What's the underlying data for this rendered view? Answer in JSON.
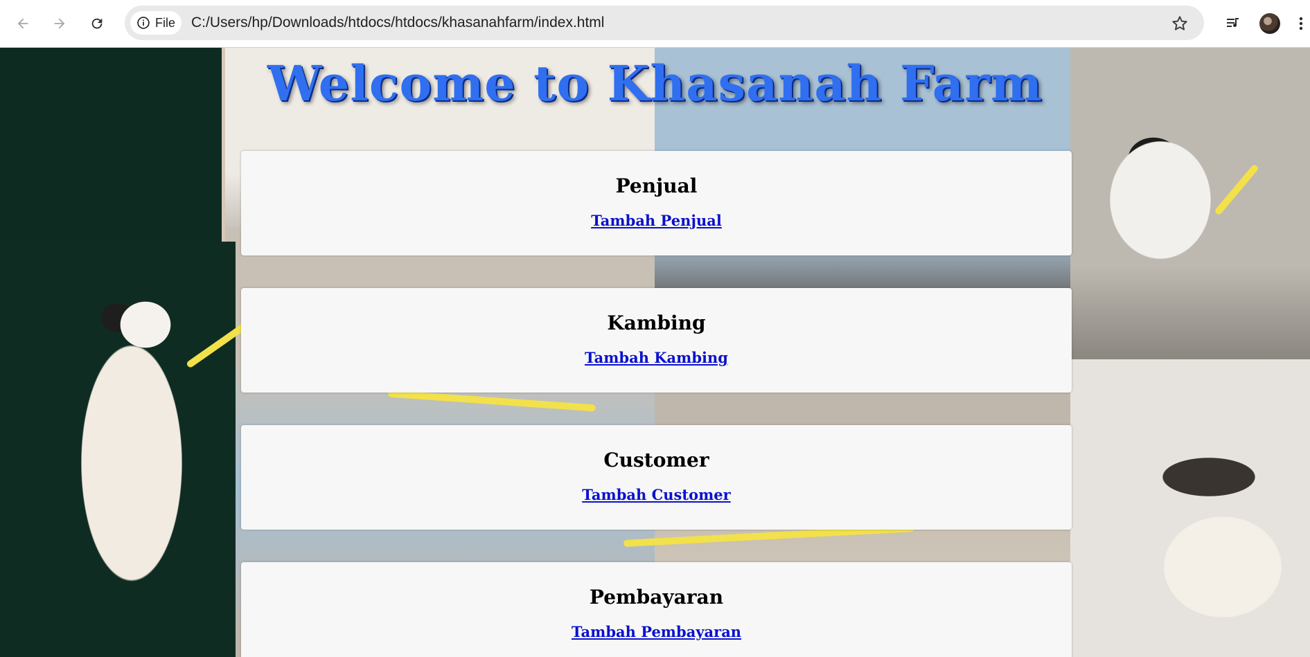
{
  "browser": {
    "chip_label": "File",
    "url": "C:/Users/hp/Downloads/htdocs/htdocs/khasanahfarm/index.html",
    "icons": [
      "back-icon",
      "forward-icon",
      "reload-icon",
      "info-icon",
      "star-icon",
      "media-control-icon",
      "avatar",
      "more-vert-icon"
    ]
  },
  "page": {
    "title": "Welcome to Khasanah Farm",
    "sections": [
      {
        "heading": "Penjual",
        "link": "Tambah Penjual"
      },
      {
        "heading": "Kambing",
        "link": "Tambah Kambing"
      },
      {
        "heading": "Customer",
        "link": "Tambah Customer"
      },
      {
        "heading": "Pembayaran",
        "link": "Tambah Pembayaran"
      }
    ]
  },
  "colors": {
    "title": "#2f6ff0",
    "link": "#0a11cc",
    "card": "#f7f7f7"
  }
}
